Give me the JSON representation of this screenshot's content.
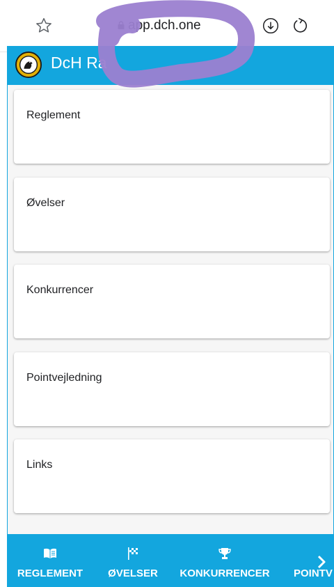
{
  "browser": {
    "url": "app.dch.one"
  },
  "header": {
    "title": "DcH Ra",
    "brand_color": "#13a6de"
  },
  "cards": [
    {
      "label": "Reglement"
    },
    {
      "label": "Øvelser"
    },
    {
      "label": "Konkurrencer"
    },
    {
      "label": "Pointvejledning"
    },
    {
      "label": "Links"
    }
  ],
  "bottom_nav": {
    "items": [
      {
        "label": "REGLEMENT",
        "icon": "book-icon"
      },
      {
        "label": "ØVELSER",
        "icon": "checkered-flag-icon"
      },
      {
        "label": "KONKURRENCER",
        "icon": "trophy-icon"
      },
      {
        "label": "POINTV",
        "icon": ""
      }
    ]
  }
}
